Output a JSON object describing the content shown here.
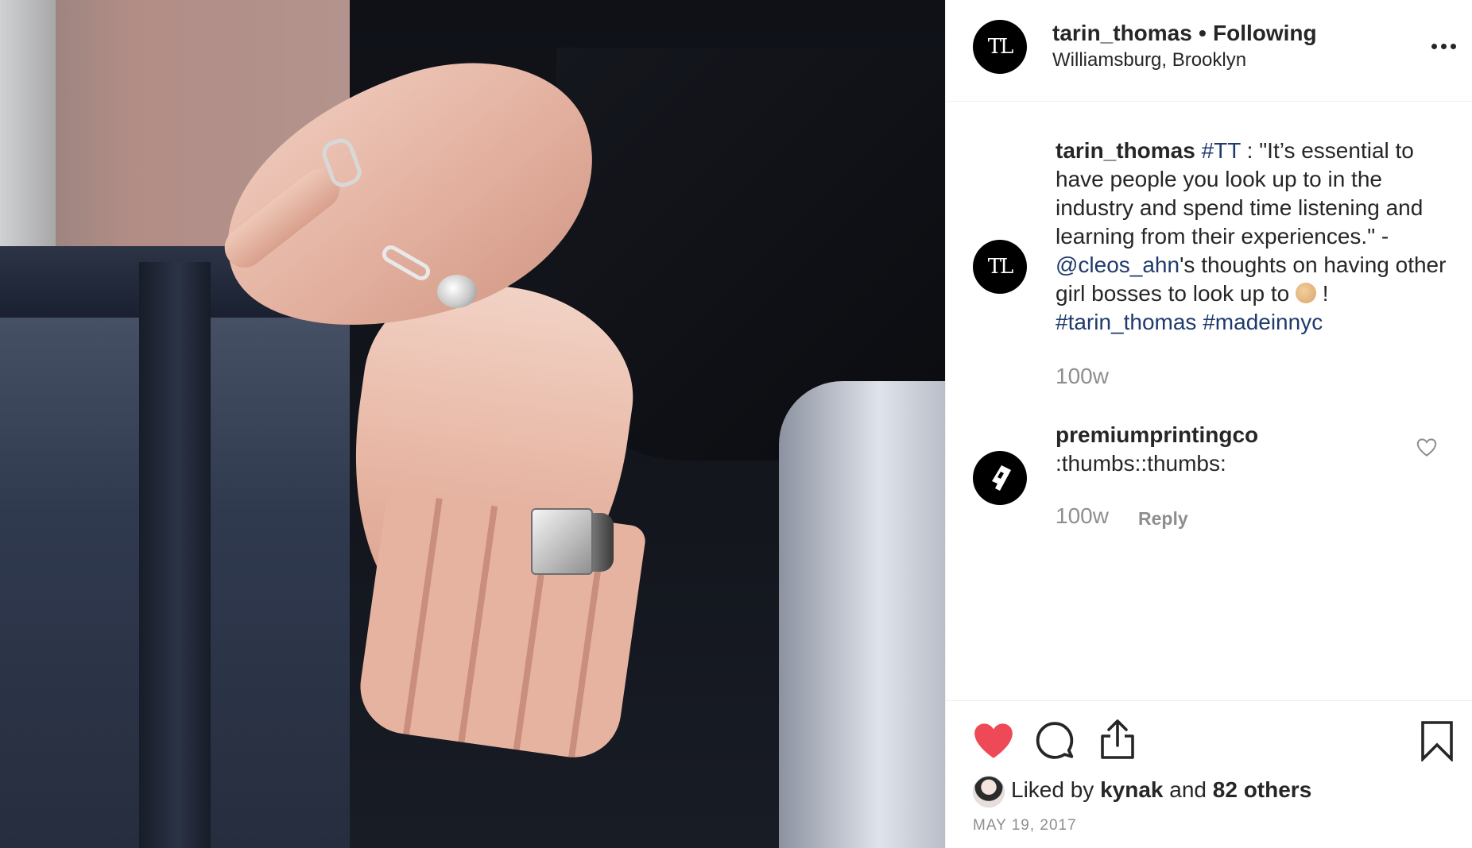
{
  "post": {
    "author": "tarin_thomas",
    "separator": "•",
    "follow_status": "Following",
    "location": "Williamsburg, Brooklyn",
    "author_avatar_text": "TL"
  },
  "caption": {
    "user": "tarin_thomas",
    "hashtag_tt": "#TT",
    "text_1": " : \"It’s essential to have people you look up to in the industry and spend time listening and learning from their experiences.\" - ",
    "mention": "@cleos_ahn",
    "text_2": "'s thoughts on having other girl bosses to look up to ",
    "text_3": " !",
    "hashtag_1": "#tarin_thomas",
    "hashtag_2": "#madeinnyc",
    "time": "100w",
    "emoji": "flexed-biceps-emoji"
  },
  "comments": [
    {
      "user": "premiumprintingco",
      "text": ":thumbs::thumbs:",
      "time": "100w",
      "reply_label": "Reply"
    }
  ],
  "actions": {
    "like_icon": "heart-filled-icon",
    "comment_icon": "comment-icon",
    "share_icon": "share-icon",
    "save_icon": "bookmark-icon",
    "like_color": "#ed4956"
  },
  "likes": {
    "prefix": "Liked by ",
    "user": "kynak",
    "middle": " and ",
    "others": "82 others"
  },
  "date": "MAY 19, 2017"
}
